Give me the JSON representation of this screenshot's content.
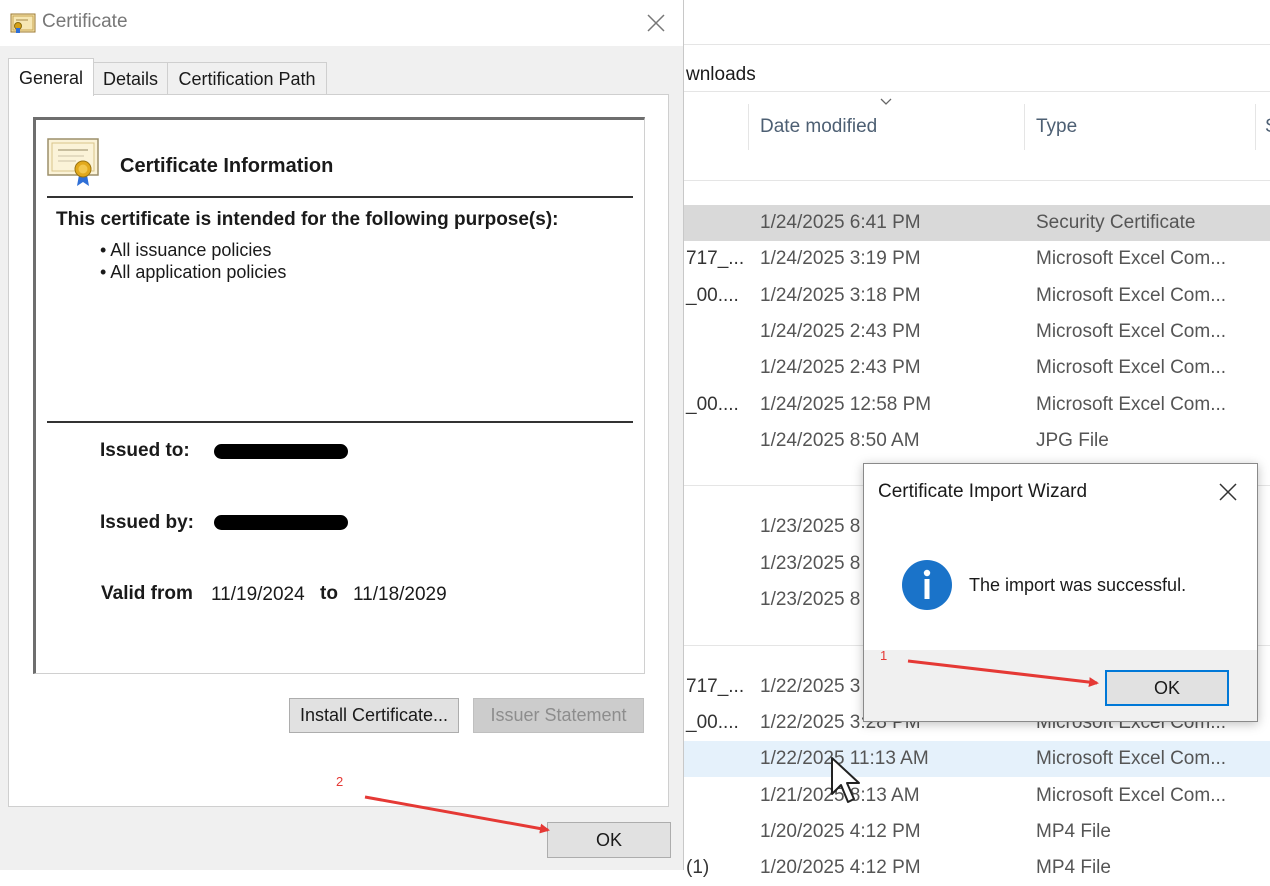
{
  "explorer": {
    "address_fragment": "wnloads",
    "columns": {
      "date": "Date modified",
      "type": "Type"
    },
    "rows": [
      {
        "name": "",
        "date": "1/24/2025 6:41 PM",
        "type": "Security Certificate",
        "state": "selected"
      },
      {
        "name": "717_...",
        "date": "1/24/2025 3:19 PM",
        "type": "Microsoft Excel Com..."
      },
      {
        "name": "_00....",
        "date": "1/24/2025 3:18 PM",
        "type": "Microsoft Excel Com..."
      },
      {
        "name": "",
        "date": "1/24/2025 2:43 PM",
        "type": "Microsoft Excel Com..."
      },
      {
        "name": "",
        "date": "1/24/2025 2:43 PM",
        "type": "Microsoft Excel Com..."
      },
      {
        "name": "_00....",
        "date": "1/24/2025 12:58 PM",
        "type": "Microsoft Excel Com..."
      },
      {
        "name": "",
        "date": "1/24/2025 8:50 AM",
        "type": "JPG File"
      },
      {
        "name": "",
        "date": "1/23/2025 8",
        "type": ""
      },
      {
        "name": "",
        "date": "1/23/2025 8",
        "type": ""
      },
      {
        "name": "",
        "date": "1/23/2025 8",
        "type": ""
      },
      {
        "name": "717_...",
        "date": "1/22/2025 3",
        "type": ""
      },
      {
        "name": "_00....",
        "date": "1/22/2025 3:28 PM",
        "type": "Microsoft Excel Com..."
      },
      {
        "name": "",
        "date": "1/22/2025 11:13 AM",
        "type": "Microsoft Excel Com...",
        "state": "hover"
      },
      {
        "name": "",
        "date": "1/21/2025 8:13 AM",
        "type": "Microsoft Excel Com..."
      },
      {
        "name": "",
        "date": "1/20/2025 4:12 PM",
        "type": "MP4 File"
      },
      {
        "name": "(1)",
        "date": "1/20/2025 4:12 PM",
        "type": "MP4 File"
      }
    ]
  },
  "cert_dialog": {
    "title": "Certificate",
    "tabs": [
      "General",
      "Details",
      "Certification Path"
    ],
    "info_title": "Certificate Information",
    "purpose_heading": "This certificate is intended for the following purpose(s):",
    "purposes": [
      "• All issuance policies",
      "• All application policies"
    ],
    "issued_to_label": "Issued to:",
    "issued_by_label": "Issued by:",
    "valid_from_label": "Valid from",
    "valid_from": "11/19/2024",
    "to_label": "to",
    "valid_to": "11/18/2029",
    "install_button": "Install Certificate...",
    "issuer_button": "Issuer Statement",
    "ok_button": "OK"
  },
  "wizard": {
    "title": "Certificate Import Wizard",
    "message": "The import was successful.",
    "ok_button": "OK"
  },
  "annotations": {
    "step1": "1",
    "step2": "2",
    "arrow_color": "#e53935"
  }
}
